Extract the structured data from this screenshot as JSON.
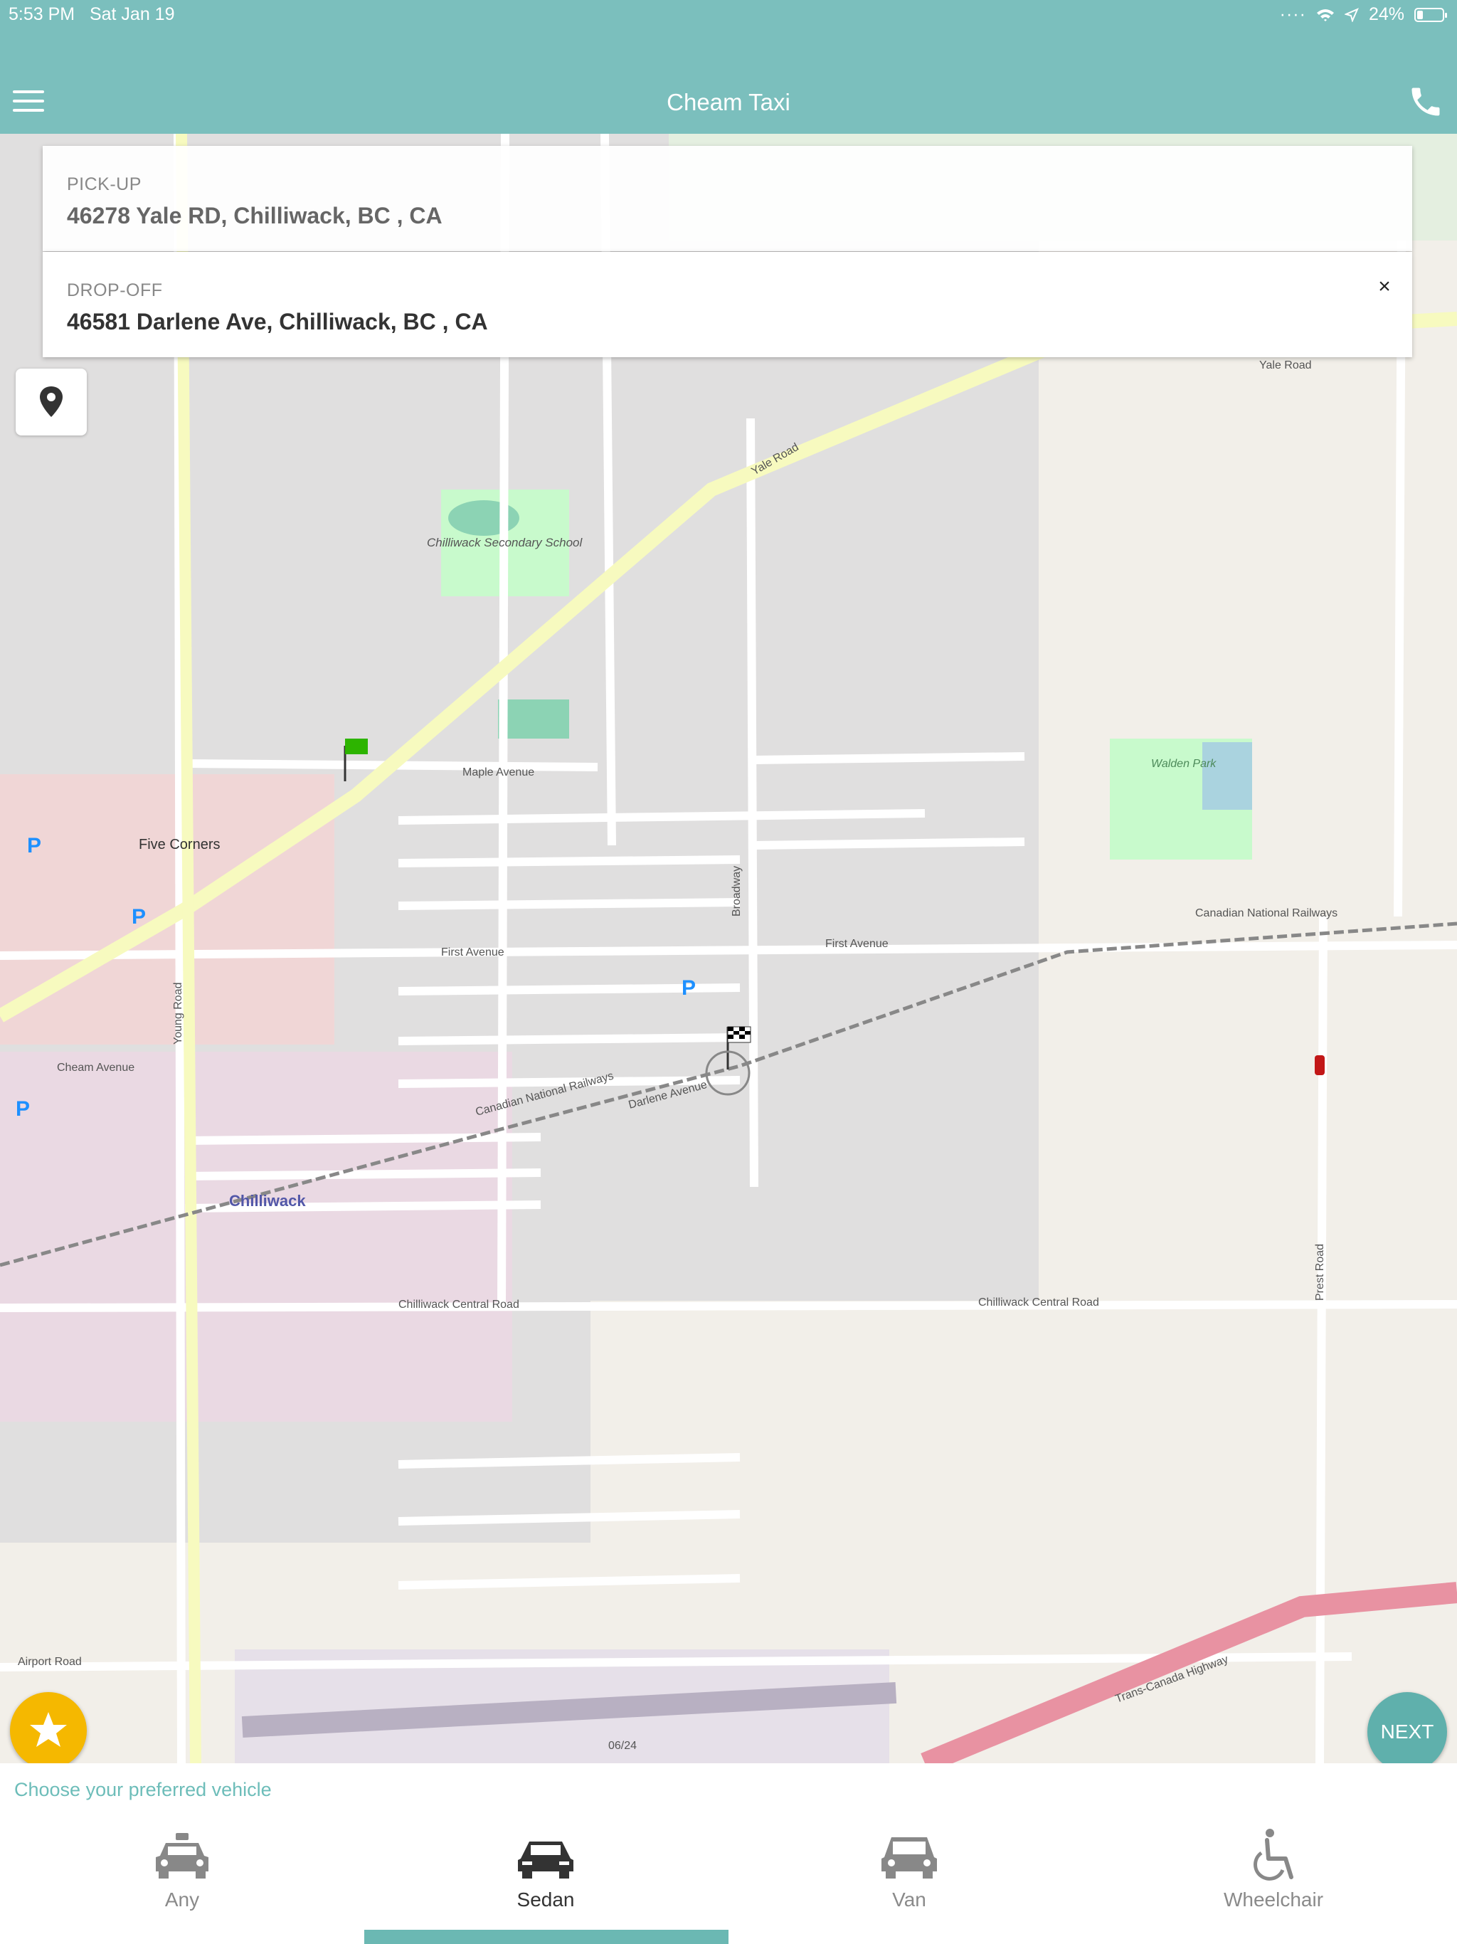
{
  "status": {
    "time": "5:53 PM",
    "date": "Sat Jan 19",
    "battery": "24%",
    "battery_level": 0.24
  },
  "header": {
    "title": "Cheam Taxi",
    "menu_icon": "hamburger-icon",
    "call_icon": "phone-icon"
  },
  "pickup": {
    "caption": "PICK-UP",
    "address": "46278 Yale RD, Chilliwack, BC , CA"
  },
  "dropoff": {
    "caption": "DROP-OFF",
    "address": "46581 Darlene Ave, Chilliwack, BC , CA",
    "clear_label": "×"
  },
  "map": {
    "labels": {
      "yale_road": "Yale Road",
      "five_corners": "Five Corners",
      "first_avenue": "First Avenue",
      "cheam_avenue": "Cheam Avenue",
      "chilliwack_central_road": "Chilliwack Central Road",
      "canadian_national_railways": "Canadian National Railways",
      "chilliwack": "Chilliwack",
      "walden_park": "Walden Park",
      "chilliwack_secondary_school": "Chilliwack Secondary School",
      "trans_canada_highway": "Trans-Canada Highway",
      "prest_road": "Prest Road",
      "young_road": "Young Road",
      "airport_road": "Airport Road",
      "broadway": "Broadway",
      "maple_avenue": "Maple Avenue",
      "darlene_avenue": "Darlene Avenue",
      "runway": "06/24"
    },
    "colors": {
      "land": "#f2efe9",
      "residential": "#e0dfdf",
      "park": "#c8facc",
      "yale_road": "#f7fabf",
      "highway": "#e892a2",
      "rail": "#888888"
    }
  },
  "buttons": {
    "next": "NEXT",
    "favorite_icon": "star-icon",
    "locate_icon": "location-pin-icon"
  },
  "vehicle_chooser": {
    "prompt": "Choose your preferred vehicle",
    "options": [
      {
        "label": "Any",
        "icon": "taxi-icon"
      },
      {
        "label": "Sedan",
        "icon": "sedan-icon"
      },
      {
        "label": "Van",
        "icon": "van-icon"
      },
      {
        "label": "Wheelchair",
        "icon": "wheelchair-icon"
      }
    ],
    "selected": "Sedan"
  }
}
